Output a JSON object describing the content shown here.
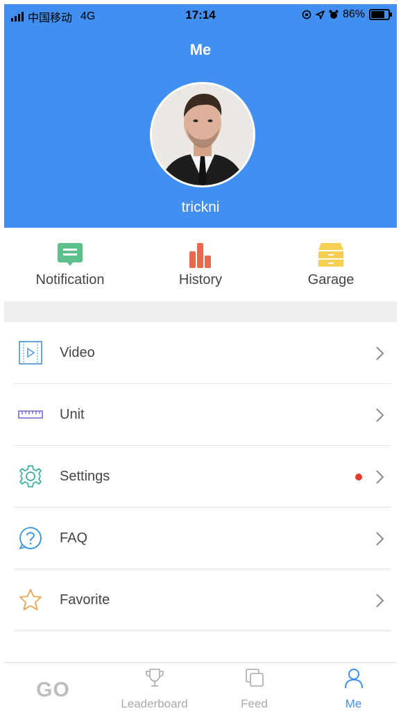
{
  "status_bar": {
    "carrier": "中国移动",
    "network": "4G",
    "time": "17:14",
    "battery": "86%",
    "battery_level": 0.86
  },
  "header": {
    "title": "Me",
    "username": "trickni"
  },
  "quick_actions": [
    {
      "label": "Notification",
      "icon": "notification-icon",
      "color": "#5ec08b"
    },
    {
      "label": "History",
      "icon": "history-bar-icon",
      "color": "#e8694d"
    },
    {
      "label": "Garage",
      "icon": "garage-drawer-icon",
      "color": "#f5ce52"
    }
  ],
  "menu": [
    {
      "label": "Video",
      "icon": "video-icon",
      "color": "#5b9bd9"
    },
    {
      "label": "Unit",
      "icon": "ruler-icon",
      "color": "#7b68d8"
    },
    {
      "label": "Settings",
      "icon": "gear-icon",
      "color": "#3db0a0",
      "badge": true
    },
    {
      "label": "FAQ",
      "icon": "question-icon",
      "color": "#3c97d6"
    },
    {
      "label": "Favorite",
      "icon": "star-icon",
      "color": "#e8a452"
    }
  ],
  "tabbar": [
    {
      "label": "GO",
      "icon": "go-logo"
    },
    {
      "label": "Leaderboard",
      "icon": "trophy-icon"
    },
    {
      "label": "Feed",
      "icon": "feed-icon"
    },
    {
      "label": "Me",
      "icon": "person-icon",
      "active": true
    }
  ],
  "colors": {
    "header_bg": "#418ff0",
    "active_tab": "#418ff0",
    "badge": "#e53b2c"
  }
}
